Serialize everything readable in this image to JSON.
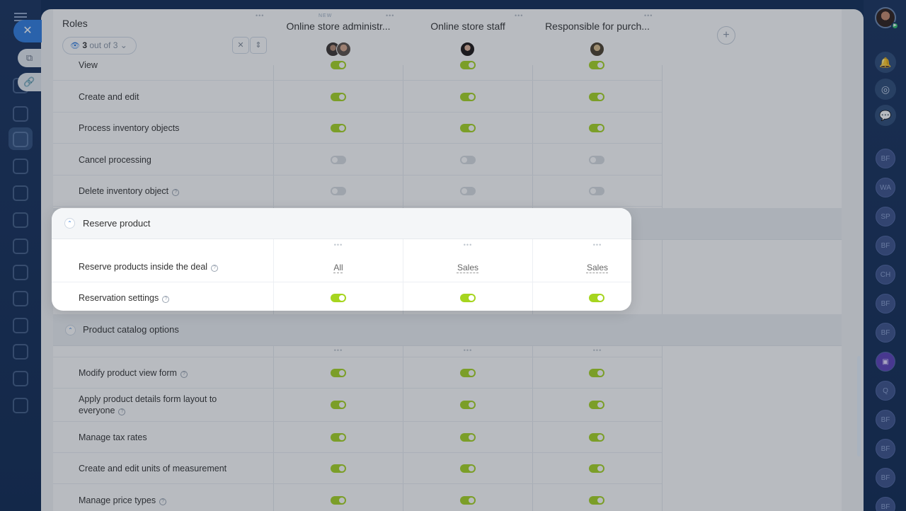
{
  "badge_new": "NEW",
  "header": {
    "roles_title": "Roles",
    "counter": {
      "current": "3",
      "rest": "out of 3"
    },
    "columns": [
      {
        "title": "Online store administr..."
      },
      {
        "title": "Online store staff"
      },
      {
        "title": "Responsible for purch..."
      }
    ],
    "add_label": "+"
  },
  "top_rows": [
    {
      "label": "View",
      "values": [
        true,
        true,
        true
      ]
    },
    {
      "label": "Create and edit",
      "values": [
        true,
        true,
        true
      ]
    },
    {
      "label": "Process inventory objects",
      "values": [
        true,
        true,
        true
      ]
    },
    {
      "label": "Cancel processing",
      "values": [
        false,
        false,
        false
      ]
    },
    {
      "label": "Delete inventory object",
      "values": [
        false,
        false,
        false
      ],
      "help": true
    }
  ],
  "reserve_section": {
    "title": "Reserve product",
    "rows": [
      {
        "label": "Reserve products inside the deal",
        "values": [
          "All",
          "Sales",
          "Sales"
        ]
      },
      {
        "label": "Reservation settings",
        "values": [
          true,
          true,
          true
        ]
      }
    ]
  },
  "catalog_section": {
    "title": "Product catalog options",
    "rows": [
      {
        "label": "Modify product view form",
        "values": [
          true,
          true,
          true
        ],
        "help": true
      },
      {
        "label_line1": "Apply product details form layout to",
        "label_line2": "everyone",
        "values": [
          true,
          true,
          true
        ],
        "help": true
      },
      {
        "label": "Manage tax rates",
        "values": [
          true,
          true,
          true
        ]
      },
      {
        "label": "Create and edit units of measurement",
        "values": [
          true,
          true,
          true
        ]
      },
      {
        "label": "Manage price types",
        "values": [
          true,
          true,
          true
        ],
        "help": true
      }
    ]
  },
  "right_sidebar": {
    "users": [
      "BF",
      "WA",
      "SP",
      "BF",
      "CH",
      "BF",
      "BF",
      "",
      "Q",
      "BF",
      "BF",
      "BF",
      "BF"
    ]
  },
  "colors": {
    "toggle_on": "#a6d51f",
    "toggle_off": "#d9dde2",
    "accent": "#2e7de1"
  }
}
